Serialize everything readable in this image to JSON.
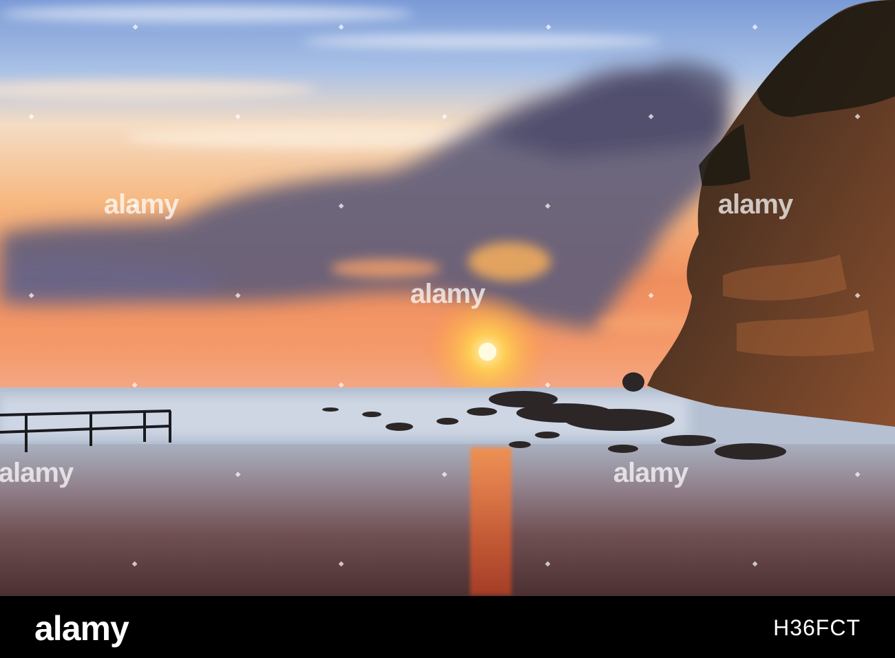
{
  "watermark": {
    "text": "alamy"
  },
  "footer": {
    "logo": "alamy",
    "image_id": "H36FCT"
  },
  "icons": [
    "sunset-scene",
    "watermark-pin-icon"
  ]
}
